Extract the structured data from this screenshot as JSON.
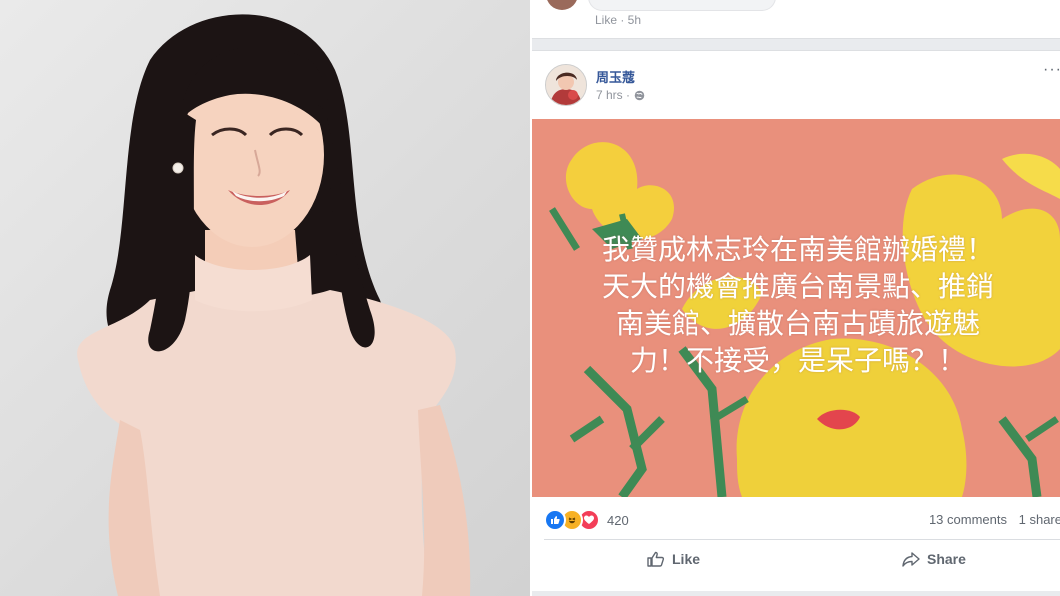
{
  "previous_comment": {
    "meta": "Like · 5h"
  },
  "post": {
    "author": "周玉蔻",
    "time": "7 hrs ·",
    "more": "···",
    "text_lines": [
      "我贊成林志玲在南美館辦婚禮！",
      "天大的機會推廣台南景點、推銷",
      "南美館、擴散台南古蹟旅遊魅",
      "力！不接受，是呆子嗎？！"
    ],
    "background_color": "#e9907c",
    "reaction_icons": [
      "like-icon",
      "haha-icon",
      "love-icon"
    ],
    "reaction_count": "420",
    "comments": "13 comments",
    "shares": "1 share",
    "like_label": "Like",
    "share_label": "Share"
  },
  "colors": {
    "author_link": "#365899",
    "meta_text": "#90949c",
    "like_blue": "#1877f2",
    "haha_yellow": "#f7b125",
    "love_red": "#f33e58"
  }
}
